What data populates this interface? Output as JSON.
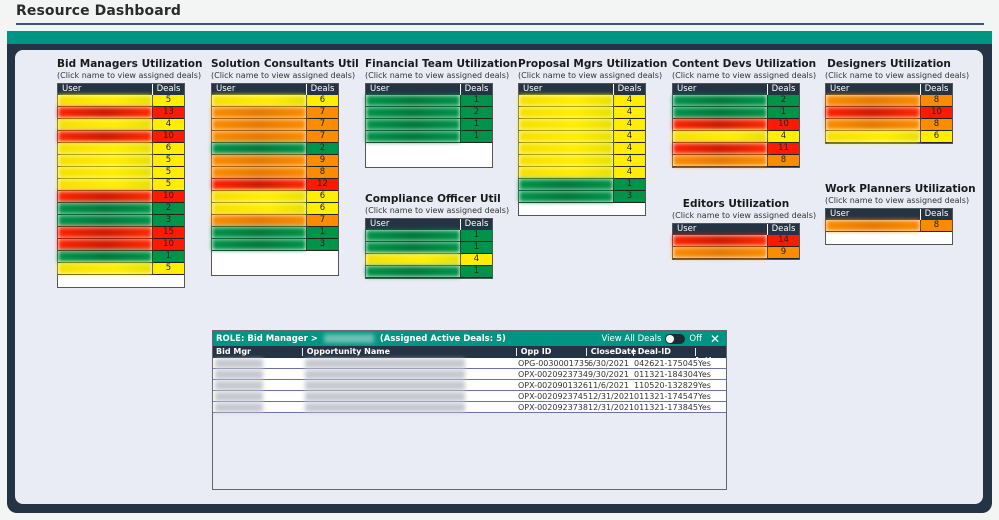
{
  "page": {
    "title": "Resource Dashboard"
  },
  "colors": {
    "yellow": "#ffee00",
    "red": "#fd1a00",
    "green": "#00944a",
    "orange": "#fb8c00",
    "teal": "#009582",
    "navy": "#253444"
  },
  "widgets": [
    {
      "id": "bid-managers",
      "title": "Bid Managers Utilization",
      "subtitle": "(Click name to view assigned deals)",
      "col_user": "User",
      "col_deals": "Deals",
      "rows": [
        {
          "deals": "5",
          "status": "yellow"
        },
        {
          "deals": "13",
          "status": "red"
        },
        {
          "deals": "4",
          "status": "yellow"
        },
        {
          "deals": "10",
          "status": "red"
        },
        {
          "deals": "6",
          "status": "yellow"
        },
        {
          "deals": "5",
          "status": "yellow"
        },
        {
          "deals": "5",
          "status": "yellow"
        },
        {
          "deals": "5",
          "status": "yellow"
        },
        {
          "deals": "10",
          "status": "red"
        },
        {
          "deals": "2",
          "status": "green"
        },
        {
          "deals": "3",
          "status": "green"
        },
        {
          "deals": "15",
          "status": "red"
        },
        {
          "deals": "10",
          "status": "red"
        },
        {
          "deals": "1",
          "status": "green"
        },
        {
          "deals": "5",
          "status": "yellow"
        }
      ]
    },
    {
      "id": "solution-consultants",
      "title": "Solution Consultants Util",
      "subtitle": "(Click name to view assigned deals)",
      "col_user": "User",
      "col_deals": "Deals",
      "rows": [
        {
          "deals": "6",
          "status": "yellow"
        },
        {
          "deals": "7",
          "status": "orange"
        },
        {
          "deals": "7",
          "status": "orange"
        },
        {
          "deals": "7",
          "status": "orange"
        },
        {
          "deals": "2",
          "status": "green"
        },
        {
          "deals": "9",
          "status": "orange"
        },
        {
          "deals": "8",
          "status": "orange"
        },
        {
          "deals": "12",
          "status": "red"
        },
        {
          "deals": "6",
          "status": "yellow"
        },
        {
          "deals": "6",
          "status": "yellow"
        },
        {
          "deals": "7",
          "status": "orange"
        },
        {
          "deals": "1",
          "status": "green"
        },
        {
          "deals": "3",
          "status": "green"
        }
      ]
    },
    {
      "id": "financial-team",
      "title": "Financial Team Utilization",
      "subtitle": "(Click name to view assigned deals)",
      "col_user": "User",
      "col_deals": "Deals",
      "rows": [
        {
          "deals": "1",
          "status": "green"
        },
        {
          "deals": "2",
          "status": "green"
        },
        {
          "deals": "1",
          "status": "green"
        },
        {
          "deals": "1",
          "status": "green"
        }
      ]
    },
    {
      "id": "compliance-officer",
      "title": "Compliance Officer Util",
      "subtitle": "(Click name to view assigned deals)",
      "col_user": "User",
      "col_deals": "Deals",
      "rows": [
        {
          "deals": "1",
          "status": "green"
        },
        {
          "deals": "1",
          "status": "green"
        },
        {
          "deals": "4",
          "status": "yellow"
        },
        {
          "deals": "1",
          "status": "green"
        }
      ]
    },
    {
      "id": "proposal-mgrs",
      "title": "Proposal Mgrs Utilization",
      "subtitle": "(Click name to view assigned deals)",
      "col_user": "User",
      "col_deals": "Deals",
      "rows": [
        {
          "deals": "4",
          "status": "yellow"
        },
        {
          "deals": "4",
          "status": "yellow"
        },
        {
          "deals": "4",
          "status": "yellow"
        },
        {
          "deals": "4",
          "status": "yellow"
        },
        {
          "deals": "4",
          "status": "yellow"
        },
        {
          "deals": "4",
          "status": "yellow"
        },
        {
          "deals": "4",
          "status": "yellow"
        },
        {
          "deals": "1",
          "status": "green"
        },
        {
          "deals": "3",
          "status": "green"
        }
      ]
    },
    {
      "id": "content-devs",
      "title": "Content Devs Utilization",
      "subtitle": "(Click name to view assigned deals)",
      "col_user": "User",
      "col_deals": "Deals",
      "rows": [
        {
          "deals": "2",
          "status": "green"
        },
        {
          "deals": "1",
          "status": "green"
        },
        {
          "deals": "10",
          "status": "red"
        },
        {
          "deals": "4",
          "status": "yellow"
        },
        {
          "deals": "11",
          "status": "red"
        },
        {
          "deals": "8",
          "status": "orange"
        }
      ]
    },
    {
      "id": "editors",
      "title": "Editors Utilization",
      "subtitle": "(Click name to view assigned deals)",
      "col_user": "User",
      "col_deals": "Deals",
      "rows": [
        {
          "deals": "14",
          "status": "red"
        },
        {
          "deals": "9",
          "status": "orange"
        }
      ]
    },
    {
      "id": "designers",
      "title": "Designers Utilization",
      "subtitle": "(Click name to view assigned deals)",
      "col_user": "User",
      "col_deals": "Deals",
      "rows": [
        {
          "deals": "8",
          "status": "orange"
        },
        {
          "deals": "10",
          "status": "red"
        },
        {
          "deals": "8",
          "status": "orange"
        },
        {
          "deals": "6",
          "status": "yellow"
        }
      ]
    },
    {
      "id": "work-planners",
      "title": "Work Planners Utilization",
      "subtitle": "(Click name to view assigned deals)",
      "col_user": "User",
      "col_deals": "Deals",
      "rows": [
        {
          "deals": "8",
          "status": "orange"
        }
      ]
    }
  ],
  "detail": {
    "role_label": "ROLE: Bid Manager >",
    "assigned_label": "(Assigned Active Deals: 5)",
    "view_all_label": "View All Deals",
    "toggle_state": "Off",
    "columns": [
      "Bid Mgr",
      "| Opportunity Name",
      "| Opp ID",
      "| CloseDate",
      "| Deal-ID",
      "| Active"
    ],
    "rows": [
      {
        "opp_id": "OPG-0030001735",
        "close_date": "6/30/2021",
        "deal_id": "042621-175045",
        "active": "Yes"
      },
      {
        "opp_id": "OPX-0020923734",
        "close_date": "9/30/2021",
        "deal_id": "011321-184304",
        "active": "Yes"
      },
      {
        "opp_id": "OPX-0020901326",
        "close_date": "11/6/2021",
        "deal_id": "110520-132829",
        "active": "Yes"
      },
      {
        "opp_id": "OPX-0020923745",
        "close_date": "12/31/2021",
        "deal_id": "011321-174547",
        "active": "Yes"
      },
      {
        "opp_id": "OPX-0020923738",
        "close_date": "12/31/2021",
        "deal_id": "011321-173845",
        "active": "Yes"
      }
    ]
  }
}
